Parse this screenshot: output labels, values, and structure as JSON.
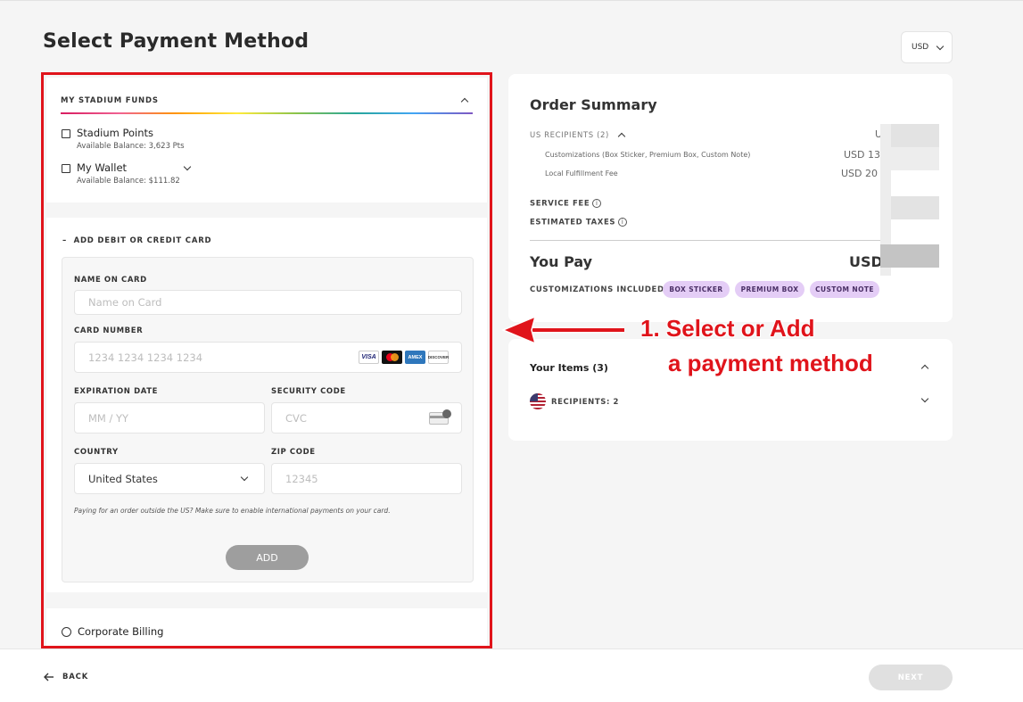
{
  "page": {
    "title": "Select Payment Method",
    "currency": "USD"
  },
  "funds": {
    "title": "MY STADIUM FUNDS",
    "points_label": "Stadium Points",
    "points_balance": "Available Balance: 3,623 Pts",
    "wallet_label": "My Wallet",
    "wallet_balance": "Available Balance: $111.82"
  },
  "card_form": {
    "section_title": "ADD DEBIT OR CREDIT CARD",
    "name_label": "NAME ON CARD",
    "name_placeholder": "Name on Card",
    "number_label": "CARD NUMBER",
    "number_placeholder": "1234 1234 1234 1234",
    "brands": [
      "VISA",
      "MASTERCARD",
      "AMEX",
      "DISCOVER"
    ],
    "expiry_label": "EXPIRATION DATE",
    "expiry_placeholder": "MM / YY",
    "cvc_label": "SECURITY CODE",
    "cvc_placeholder": "CVC",
    "country_label": "COUNTRY",
    "country_value": "United States",
    "zip_label": "ZIP CODE",
    "zip_placeholder": "12345",
    "intl_note": "Paying for an order outside the US? Make sure to enable international payments on your card.",
    "add_label": "ADD"
  },
  "corporate": {
    "label": "Corporate Billing"
  },
  "summary": {
    "title": "Order Summary",
    "recipients_label": "US RECIPIENTS (2)",
    "recipients_amount": "U",
    "customizations_label": "Customizations (Box Sticker, Premium Box, Custom Note)",
    "customizations_amount": "USD 13",
    "fulfillment_label": "Local Fulfillment Fee",
    "fulfillment_amount": "USD 20",
    "service_fee_label": "SERVICE FEE",
    "taxes_label": "ESTIMATED TAXES",
    "info_glyph": "i",
    "you_pay_label": "You Pay",
    "you_pay_amount": "USD",
    "included_label": "CUSTOMIZATIONS INCLUDED:",
    "tags": [
      "BOX STICKER",
      "PREMIUM BOX",
      "CUSTOM NOTE"
    ]
  },
  "items": {
    "title": "Your Items (3)",
    "recipients": "RECIPIENTS: 2"
  },
  "annotation": {
    "line1": "1. Select or Add",
    "line2": "a payment method",
    "color": "#e0141b"
  },
  "footer": {
    "back_label": "BACK",
    "next_label": "NEXT"
  }
}
